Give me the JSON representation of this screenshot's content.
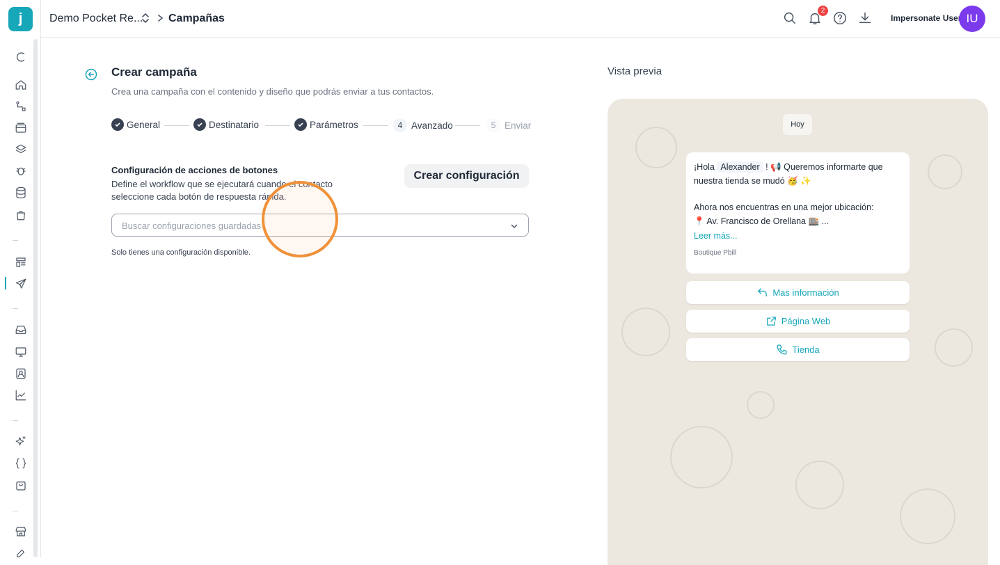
{
  "app": {
    "logo_letter": "j",
    "accent": "#16a7b9"
  },
  "header": {
    "org": "Demo Pocket Re...",
    "page": "Campañas",
    "notification_count": "2",
    "user_name": "Impersonate User",
    "avatar_initials": "IU"
  },
  "sidebar": {
    "icons": [
      "collapse-icon",
      "home-icon",
      "flow-icon",
      "archive-icon",
      "layers-icon",
      "bug-icon",
      "database-icon",
      "bag-icon",
      "templates-icon",
      "send-icon",
      "inbox-icon",
      "monitor-icon",
      "contact-icon",
      "chart-icon",
      "sparkles-icon",
      "braces-icon",
      "cart-icon",
      "store-icon",
      "tools-icon"
    ],
    "active": "send-icon"
  },
  "form": {
    "title": "Crear campaña",
    "subtitle": "Crea una campaña con el contenido y diseño que podrás enviar a tus contactos.",
    "steps": [
      {
        "label": "General",
        "state": "done"
      },
      {
        "label": "Destinatario",
        "state": "done"
      },
      {
        "label": "Parámetros",
        "state": "done"
      },
      {
        "label": "Avanzado",
        "number": "4",
        "state": "current"
      },
      {
        "label": "Enviar",
        "number": "5",
        "state": "pending"
      }
    ],
    "config_title": "Configuración de acciones de botones",
    "config_desc": "Define el workflow que se ejecutará cuando el contacto seleccione cada botón de respuesta rápida.",
    "create_label": "Crear configuración",
    "search_placeholder": "Buscar configuraciones guardadas",
    "hint": "Solo tienes una configuración disponible."
  },
  "preview": {
    "title": "Vista previa",
    "date": "Hoy",
    "greeting": "¡Hola",
    "variable": "Alexander",
    "line1_rest": "! 📢 Queremos informarte que",
    "line2": "nuestra tienda se mudó 🥳 ✨",
    "line3": "Ahora nos encuentras en una mejor ubicación:",
    "line4": "📍 Av. Francisco de Orellana 🏬 ...",
    "read_more": "Leer más...",
    "footer": "Boutique Pbill",
    "buttons": [
      "Mas información",
      "Página Web",
      "Tienda"
    ]
  }
}
